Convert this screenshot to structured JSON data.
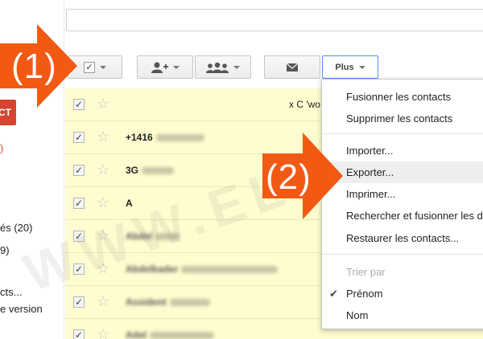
{
  "sidebar": {
    "button_label": "CT",
    "red_count": ")",
    "items": [
      {
        "label": "és (20)"
      },
      {
        "label": "9)"
      },
      {
        "label": "cts..."
      },
      {
        "label": "e version"
      }
    ]
  },
  "toolbar": {
    "more_label": "Plus"
  },
  "annotations": {
    "step1": "(1)",
    "step2": "(2)",
    "arrow_color": "#f25a14"
  },
  "rows": [
    {
      "name": "",
      "extra": "x C 'wo"
    },
    {
      "name": "+1416",
      "extra": ""
    },
    {
      "name": "3G",
      "extra": ""
    },
    {
      "name": "A",
      "extra": ""
    },
    {
      "name": "Abdel",
      "extra": ""
    },
    {
      "name": "Abdelkader",
      "extra": ""
    },
    {
      "name": "Assident",
      "extra": ""
    },
    {
      "name": "Adel",
      "extra": ""
    }
  ],
  "menu": {
    "items": [
      {
        "label": "Fusionner les contacts"
      },
      {
        "label": "Supprimer les contacts"
      },
      {
        "label": "Importer..."
      },
      {
        "label": "Exporter..."
      },
      {
        "label": "Imprimer..."
      },
      {
        "label": "Rechercher et fusionner les d"
      },
      {
        "label": "Restaurer les contacts..."
      }
    ],
    "sort_header": "Trier par",
    "sort_options": [
      {
        "label": "Prénom",
        "checked": true
      },
      {
        "label": "Nom",
        "checked": false
      }
    ]
  },
  "watermark": "WWW.ELECTRODZ.C",
  "colors": {
    "row_highlight": "#fffdcf",
    "danger_button": "#d64532",
    "focus_blue": "#4d90fe"
  }
}
